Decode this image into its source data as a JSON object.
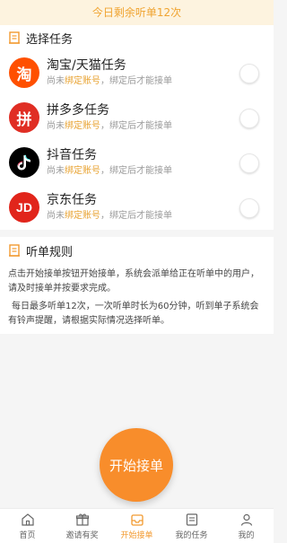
{
  "banner": {
    "text": "今日剩余听单12次"
  },
  "tasks_section": {
    "title": "选择任务"
  },
  "tasks": [
    {
      "name": "淘宝/天猫任务",
      "logo_text": "淘",
      "logo_color": "#ff5000",
      "status_prefix": "尚未",
      "status_link": "绑定账号",
      "status_suffix": "，绑定后才能接单"
    },
    {
      "name": "拼多多任务",
      "logo_text": "拼",
      "logo_color": "#e02e24",
      "status_prefix": "尚未",
      "status_link": "绑定账号",
      "status_suffix": "，绑定后才能接单"
    },
    {
      "name": "抖音任务",
      "logo_text": "",
      "logo_color": "#000000",
      "status_prefix": "尚未",
      "status_link": "绑定账号",
      "status_suffix": "，绑定后才能接单"
    },
    {
      "name": "京东任务",
      "logo_text": "JD",
      "logo_color": "#e1251b",
      "status_prefix": "尚未",
      "status_link": "绑定账号",
      "status_suffix": "，绑定后才能接单"
    }
  ],
  "rules_section": {
    "title": "听单规则",
    "para1": "点击开始接单按钮开始接单，系统会派单给正在听单中的用户，请及时接单并按要求完成。",
    "para2": "每日最多听单12次，一次听单时长为60分钟，听到单子系统会有铃声提醒，请根据实际情况选择听单。"
  },
  "start_button": {
    "label": "开始接单"
  },
  "tabbar": {
    "items": [
      {
        "label": "首页",
        "icon": "home-icon"
      },
      {
        "label": "邀请有奖",
        "icon": "gift-icon"
      },
      {
        "label": "开始接单",
        "icon": "inbox-icon",
        "active": true
      },
      {
        "label": "我的任务",
        "icon": "list-icon"
      },
      {
        "label": "我的",
        "icon": "user-icon"
      }
    ]
  },
  "colors": {
    "accent": "#f88d2b",
    "banner_bg": "#fdf3df",
    "banner_text": "#f0a431",
    "link": "#e8a230"
  }
}
